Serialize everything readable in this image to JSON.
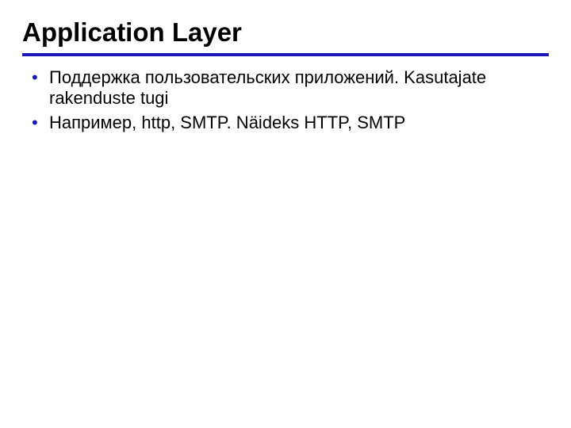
{
  "slide": {
    "title": "Application Layer",
    "bullets": [
      "Поддержка пользовательских приложений. Kasutajate rakenduste tugi",
      "Например, http, SMTP. Näideks HTTP, SMTP"
    ]
  }
}
